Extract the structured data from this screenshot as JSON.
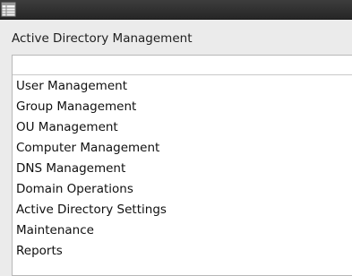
{
  "window": {
    "title": "Active Directory Management"
  },
  "menu": {
    "items": [
      {
        "label": "User Management"
      },
      {
        "label": "Group Management"
      },
      {
        "label": "OU Management"
      },
      {
        "label": "Computer Management"
      },
      {
        "label": "DNS Management"
      },
      {
        "label": "Domain Operations"
      },
      {
        "label": "Active Directory Settings"
      },
      {
        "label": "Maintenance"
      },
      {
        "label": "Reports"
      }
    ]
  },
  "colors": {
    "titlebar": "#2f2f2f",
    "background": "#ebebeb",
    "panel": "#ffffff"
  },
  "icons": {
    "app": "table-icon"
  }
}
